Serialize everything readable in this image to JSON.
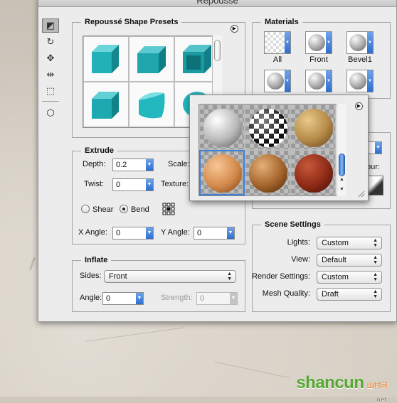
{
  "window": {
    "title": "Repoussé"
  },
  "tools": [
    {
      "icon": "lasso-rotate-icon",
      "glyph": "◩"
    },
    {
      "icon": "rotate-icon",
      "glyph": "↻"
    },
    {
      "icon": "move-icon",
      "glyph": "✥"
    },
    {
      "icon": "slide-icon",
      "glyph": "⇹"
    },
    {
      "icon": "scale-icon",
      "glyph": "⬚"
    },
    {
      "icon": "cube-view-icon",
      "glyph": "⬡"
    }
  ],
  "shape_presets": {
    "title": "Repoussé Shape Presets",
    "colors": {
      "cube": "#21b1b7",
      "cube_shade": "#12878d"
    }
  },
  "extrude": {
    "title": "Extrude",
    "depth_label": "Depth:",
    "depth_value": "0.2",
    "scale_label": "Scale:",
    "twist_label": "Twist:",
    "twist_value": "0",
    "texture_label": "Texture:",
    "shear_label": "Shear",
    "bend_label": "Bend",
    "bend_selected": true,
    "x_angle_label": "X Angle:",
    "x_angle_value": "0",
    "y_angle_label": "Y Angle:",
    "y_angle_value": "0"
  },
  "inflate": {
    "title": "Inflate",
    "sides_label": "Sides:",
    "sides_value": "Front",
    "angle_label": "Angle:",
    "angle_value": "0",
    "strength_label": "Strength:",
    "strength_value": "0"
  },
  "materials": {
    "title": "Materials",
    "labels": [
      "All",
      "Front",
      "Bevel1"
    ],
    "partial_label": "our:"
  },
  "material_popup": {
    "swatches": [
      {
        "name": "chrome-material",
        "colors": [
          "#ffffff",
          "#b9b9b9",
          "#555555"
        ]
      },
      {
        "name": "checker-material",
        "colors": [
          "#ffffff",
          "#111111"
        ]
      },
      {
        "name": "gold-texture-material",
        "colors": [
          "#e8c98a",
          "#b58a46",
          "#5a3d17"
        ]
      },
      {
        "name": "orange-material",
        "colors": [
          "#f7c796",
          "#d48a4c",
          "#7e4315"
        ]
      },
      {
        "name": "wood-material",
        "colors": [
          "#e3b077",
          "#a3642a",
          "#4a260b"
        ]
      },
      {
        "name": "red-material",
        "colors": [
          "#c6583a",
          "#8e2a16",
          "#3d0c05"
        ]
      }
    ],
    "selected_index": 3
  },
  "scene_settings": {
    "title": "Scene Settings",
    "lights_label": "Lights:",
    "lights_value": "Custom",
    "view_label": "View:",
    "view_value": "Default",
    "render_label": "Render Settings:",
    "render_value": "Custom",
    "quality_label": "Mesh Quality:",
    "quality_value": "Draft"
  },
  "watermark": {
    "text": "shancun",
    "cn": "山村网",
    "sub": ".net"
  }
}
